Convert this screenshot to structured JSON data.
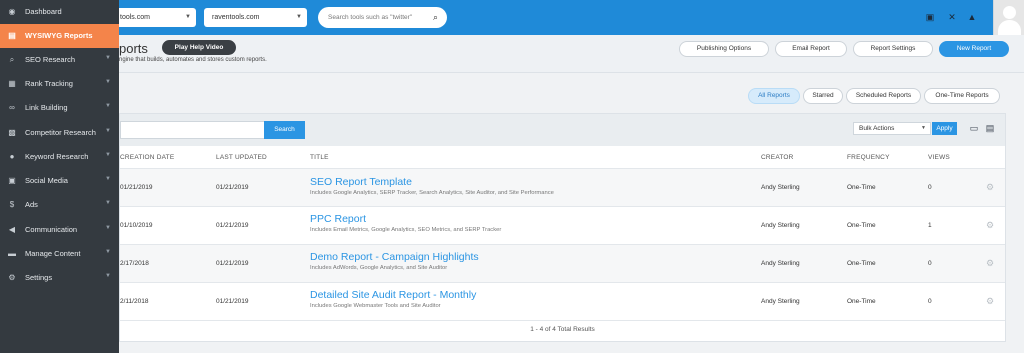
{
  "topbar": {
    "site_select": "raventools.com",
    "site_select_partial": "tools.com",
    "search_placeholder": "Search tools such as \"twitter\""
  },
  "sidebar": {
    "items": [
      {
        "label": "Dashboard",
        "icon": "dashboard-icon"
      },
      {
        "label": "WYSIWYG Reports",
        "icon": "reports-icon",
        "active": true
      },
      {
        "label": "SEO Research",
        "icon": "search-icon"
      },
      {
        "label": "Rank Tracking",
        "icon": "rank-icon"
      },
      {
        "label": "Link Building",
        "icon": "link-icon"
      },
      {
        "label": "Competitor Research",
        "icon": "competitor-icon"
      },
      {
        "label": "Keyword Research",
        "icon": "keyword-icon"
      },
      {
        "label": "Social Media",
        "icon": "social-icon"
      },
      {
        "label": "Ads",
        "icon": "ads-icon"
      },
      {
        "label": "Communication",
        "icon": "megaphone-icon"
      },
      {
        "label": "Manage Content",
        "icon": "content-icon"
      },
      {
        "label": "Settings",
        "icon": "gear-icon"
      }
    ]
  },
  "page": {
    "title_partial": "ports",
    "subtitle_partial": "ngine that builds, automates and stores custom reports.",
    "play_help": "Play Help Video",
    "actions": {
      "publishing": "Publishing Options",
      "email": "Email Report",
      "settings": "Report Settings",
      "new": "New Report"
    }
  },
  "filters": {
    "all": "All Reports",
    "starred": "Starred",
    "scheduled": "Scheduled Reports",
    "onetime": "One-Time Reports"
  },
  "toolbar": {
    "search_button": "Search",
    "bulk_actions": "Bulk Actions",
    "apply": "Apply"
  },
  "table": {
    "headers": {
      "created": "CREATION DATE",
      "updated": "LAST UPDATED",
      "title": "TITLE",
      "creator": "CREATOR",
      "frequency": "FREQUENCY",
      "views": "VIEWS"
    },
    "rows": [
      {
        "created": "01/21/2019",
        "updated": "01/21/2019",
        "title": "SEO Report Template",
        "desc": "Includes Google Analytics, SERP Tracker, Search Analytics, Site Auditor, and Site Performance",
        "creator": "Andy Sterling",
        "frequency": "One-Time",
        "views": "0"
      },
      {
        "created": "01/10/2019",
        "updated": "01/21/2019",
        "title": "PPC Report",
        "desc": "Includes Email Metrics, Google Analytics, SEO Metrics, and SERP Tracker",
        "creator": "Andy Sterling",
        "frequency": "One-Time",
        "views": "1"
      },
      {
        "created": "2/17/2018",
        "updated": "01/21/2019",
        "title": "Demo Report - Campaign Highlights",
        "desc": "Includes AdWords, Google Analytics, and Site Auditor",
        "creator": "Andy Sterling",
        "frequency": "One-Time",
        "views": "0"
      },
      {
        "created": "2/11/2018",
        "updated": "01/21/2019",
        "title": "Detailed Site Audit Report - Monthly",
        "desc": "Includes Google Webmaster Tools and Site Auditor",
        "creator": "Andy Sterling",
        "frequency": "One-Time",
        "views": "0"
      }
    ],
    "footer": "1 - 4 of 4 Total Results"
  },
  "colors": {
    "brand_blue": "#1f8ad8",
    "accent_orange": "#f4844a",
    "sidebar_bg": "#343a40"
  }
}
